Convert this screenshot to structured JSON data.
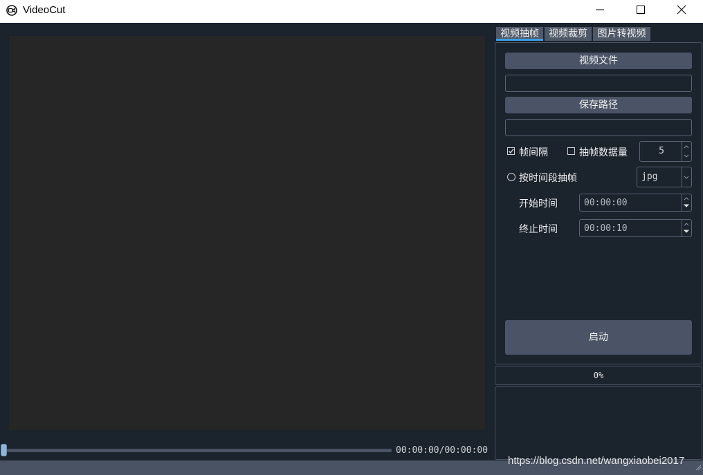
{
  "window": {
    "title": "VideoCut"
  },
  "player": {
    "time": "00:00:00/00:00:00",
    "position": 0
  },
  "tabs": [
    {
      "label": "视频抽帧",
      "active": true
    },
    {
      "label": "视频裁剪",
      "active": false
    },
    {
      "label": "图片转视频",
      "active": false
    }
  ],
  "extract": {
    "video_file_button": "视频文件",
    "video_file_value": "",
    "save_path_button": "保存路径",
    "save_path_value": "",
    "frame_interval_label": "帧间隔",
    "frame_interval_checked": true,
    "frame_count_label": "抽帧数据量",
    "frame_count_checked": false,
    "count_value": "5",
    "by_time_label": "按时间段抽帧",
    "format_value": "jpg",
    "start_time_label": "开始时间",
    "start_time_value": "00:00:00",
    "end_time_label": "终止时间",
    "end_time_value": "00:00:10",
    "start_button": "启动"
  },
  "progress": {
    "text": "0%",
    "value": 0
  },
  "watermark": "https://blog.csdn.net/wangxiaobei2017",
  "colors": {
    "accent": "#3aa0e8",
    "panel_bg": "#1b232d",
    "button": "#4a5466",
    "video_bg": "#262626"
  }
}
